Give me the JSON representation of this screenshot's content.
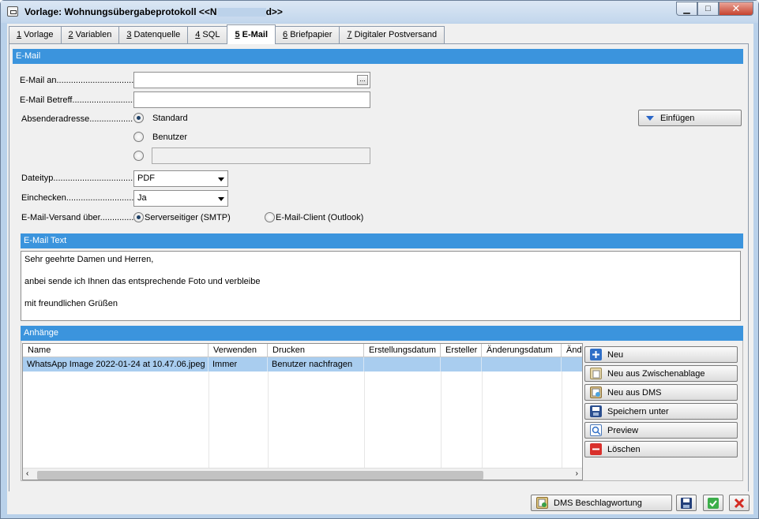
{
  "window": {
    "title_prefix": "Vorlage: Wohnungsübergabeprotokoll  <<N",
    "title_suffix": "d>>",
    "minimize_label": "▁",
    "maximize_label": "□",
    "close_label": "✕"
  },
  "tabs": [
    {
      "num": "1",
      "label": " Vorlage"
    },
    {
      "num": "2",
      "label": " Variablen"
    },
    {
      "num": "3",
      "label": " Datenquelle"
    },
    {
      "num": "4",
      "label": " SQL"
    },
    {
      "num": "5",
      "label": " E-Mail"
    },
    {
      "num": "6",
      "label": " Briefpapier"
    },
    {
      "num": "7",
      "label": " Digitaler Postversand"
    }
  ],
  "email": {
    "section_title": "E-Mail",
    "to_label": "E-Mail an..................................",
    "to_value": "",
    "subject_label": "E-Mail Betreff...........................",
    "subject_value": "",
    "sender_label": "Absenderadresse..................",
    "sender_options": [
      "Standard",
      "Benutzer"
    ],
    "sender_custom_value": "",
    "insert_button": "Einfügen",
    "filetype_label": "Dateityp...................................",
    "filetype_value": "PDF",
    "checkin_label": "Einchecken...............................",
    "checkin_value": "Ja",
    "dispatch_label": "E-Mail-Versand über...............",
    "dispatch_options": [
      "Serverseitiger (SMTP)",
      "E-Mail-Client (Outlook)"
    ]
  },
  "email_text": {
    "section_title": "E-Mail Text",
    "lines": [
      "Sehr geehrte Damen und Herren,",
      "anbei sende ich Ihnen das entsprechende Foto und verbleibe",
      "mit freundlichen Grüßen"
    ]
  },
  "attachments": {
    "section_title": "Anhänge",
    "columns": [
      "Name",
      "Verwenden",
      "Drucken",
      "Erstellungsdatum",
      "Ersteller",
      "Änderungsdatum",
      "Änd"
    ],
    "rows": [
      [
        "WhatsApp Image 2022-01-24 at 10.47.06.jpeg",
        "Immer",
        "Benutzer nachfragen",
        "",
        "",
        "",
        ""
      ]
    ],
    "buttons": [
      "Neu",
      "Neu aus Zwischenablage",
      "Neu aus DMS",
      "Speichern unter",
      "Preview",
      "Löschen"
    ]
  },
  "footer": {
    "dms_button": "DMS Beschlagwortung"
  },
  "colors": {
    "section_header": "#3b94dd",
    "selected_row": "#a9cdef"
  }
}
